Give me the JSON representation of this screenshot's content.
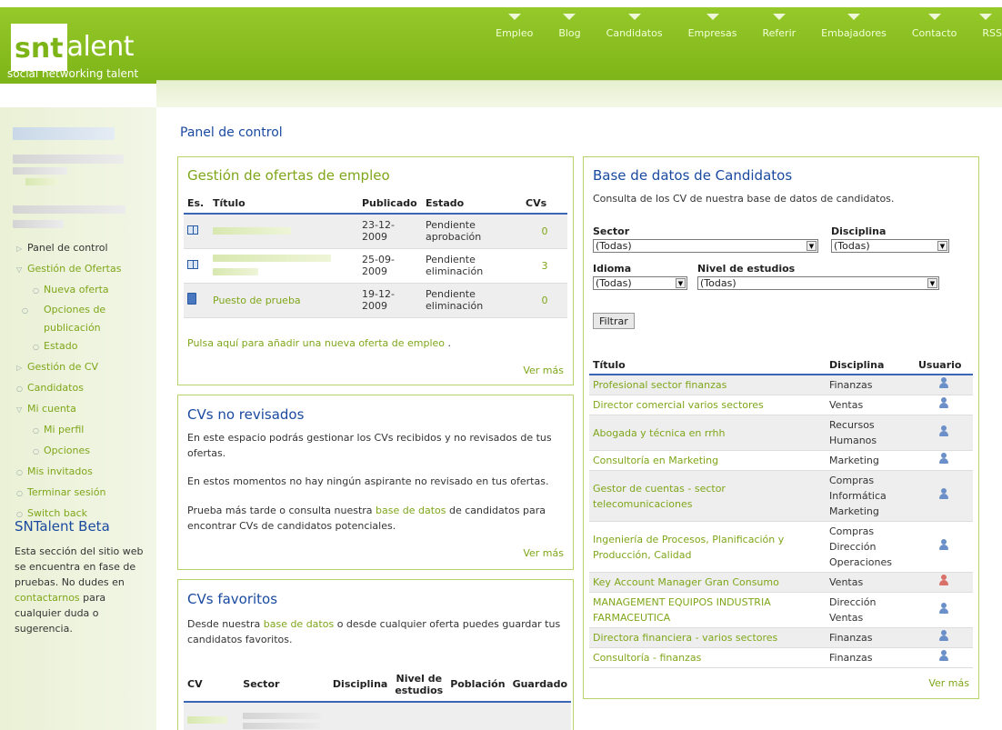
{
  "brand": {
    "logo_box": "snt",
    "logo_rest": "alent",
    "tagline": "social networking talent"
  },
  "nav": [
    "Empleo",
    "Blog",
    "Candidatos",
    "Empresas",
    "Referir",
    "Embajadores",
    "Contacto",
    "RSS"
  ],
  "sidebar": {
    "menu": [
      {
        "label": "Panel de control",
        "marker": "▷",
        "level": 0
      },
      {
        "label": "Gestión de Ofertas",
        "marker": "▽",
        "level": 0
      },
      {
        "label": "Nueva oferta",
        "marker": "○",
        "level": 1
      },
      {
        "label": "Opciones de publicación",
        "marker": "○",
        "level": 1
      },
      {
        "label": "Estado",
        "marker": "○",
        "level": 1
      },
      {
        "label": "Gestión de CV",
        "marker": "▷",
        "level": 0
      },
      {
        "label": "Candidatos",
        "marker": "○",
        "level": 0
      },
      {
        "label": "Mi cuenta",
        "marker": "▽",
        "level": 0
      },
      {
        "label": "Mi perfil",
        "marker": "○",
        "level": 1
      },
      {
        "label": "Opciones",
        "marker": "○",
        "level": 1
      },
      {
        "label": "Mis invitados",
        "marker": "○",
        "level": 0
      },
      {
        "label": "Terminar sesión",
        "marker": "○",
        "level": 0
      },
      {
        "label": "Switch back",
        "marker": "○",
        "level": 0
      }
    ],
    "beta_title": "SNTalent Beta",
    "beta_text_1": "Esta sección del sitio web se encuentra en fase de pruebas. No dudes en",
    "beta_link": "contactarnos",
    "beta_text_2": "para cualquier duda o sugerencia."
  },
  "main": {
    "page_title": "Panel de control",
    "offers": {
      "title": "Gestión de ofertas de empleo",
      "headers": [
        "Es.",
        "Título",
        "Publicado",
        "Estado",
        "CVs"
      ],
      "rows": [
        {
          "title": "",
          "date": "23-12-2009",
          "status": "Pendiente aprobación",
          "cvs": "0"
        },
        {
          "title": "",
          "date": "25-09-2009",
          "status": "Pendiente eliminación",
          "cvs": "3"
        },
        {
          "title": "Puesto de prueba",
          "date": "19-12-2009",
          "status": "Pendiente eliminación",
          "cvs": "0"
        }
      ],
      "add_link": "Pulsa aquí para añadir una nueva oferta de empleo",
      "add_suffix": " .",
      "more": "Ver más"
    },
    "unreviewed": {
      "title": "CVs no revisados",
      "p1": "En este espacio podrás gestionar los CVs recibidos y no revisados de tus ofertas.",
      "p2": "En estos momentos no hay ningún aspirante no revisado en tus ofertas.",
      "p3_a": "Prueba más tarde o consulta nuestra ",
      "p3_link": "base de datos",
      "p3_b": " de candidatos para encontrar CVs de candidatos potenciales.",
      "more": "Ver más"
    },
    "favorites": {
      "title": "CVs favoritos",
      "p_a": "Desde nuestra ",
      "p_link": "base de datos",
      "p_b": " o desde cualquier oferta puedes guardar tus candidatos favoritos.",
      "headers": [
        "CV",
        "Sector",
        "Disciplina",
        "Nivel de estudios",
        "Población",
        "Guardado"
      ]
    },
    "candidates": {
      "title": "Base de datos de Candidatos",
      "intro": "Consulta de los CV de nuestra base de datos de candidatos.",
      "sector_label": "Sector",
      "sector_value": "(Todas)",
      "disciplina_label": "Disciplina",
      "disciplina_value": "(Todas)",
      "idioma_label": "Idioma",
      "idioma_value": "(Todas)",
      "nivel_label": "Nivel de estudios",
      "nivel_value": "(Todas)",
      "filter_button": "Filtrar",
      "headers": [
        "Título",
        "Disciplina",
        "Usuario"
      ],
      "rows": [
        {
          "title": "Profesional sector finanzas",
          "disc": "Finanzas",
          "user_color": "blue"
        },
        {
          "title": "Director comercial varios sectores",
          "disc": "Ventas",
          "user_color": "blue"
        },
        {
          "title": "Abogada y técnica en rrhh",
          "disc": "Recursos\nHumanos",
          "user_color": "blue"
        },
        {
          "title": "Consultoría en Marketing",
          "disc": "Marketing",
          "user_color": "blue"
        },
        {
          "title": "Gestor de cuentas - sector telecomunicaciones",
          "disc": "Compras\nInformática\nMarketing",
          "user_color": "blue"
        },
        {
          "title": "Ingeniería de Procesos, Planificación y Producción, Calidad",
          "disc": "Compras\nDirección\nOperaciones",
          "user_color": "blue"
        },
        {
          "title": "Key Account Manager Gran Consumo",
          "disc": "Ventas",
          "user_color": "red"
        },
        {
          "title": "MANAGEMENT EQUIPOS INDUSTRIA FARMACEUTICA",
          "disc": "Dirección\nVentas",
          "user_color": "blue"
        },
        {
          "title": "Directora financiera - varios sectores",
          "disc": "Finanzas",
          "user_color": "blue"
        },
        {
          "title": "Consultoría - finanzas",
          "disc": "Finanzas",
          "user_color": "blue"
        }
      ],
      "more": "Ver más"
    }
  }
}
